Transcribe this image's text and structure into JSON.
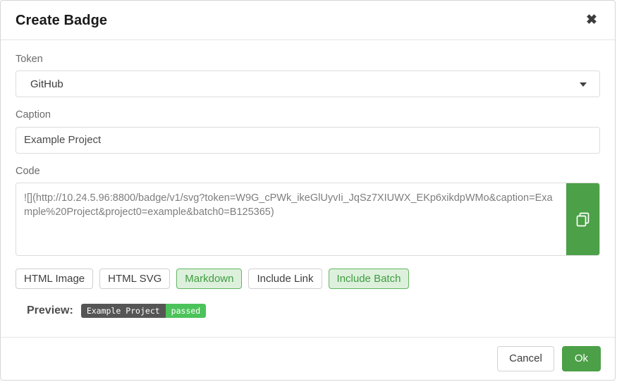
{
  "dialog": {
    "title": "Create Badge",
    "close_icon": "close-icon"
  },
  "form": {
    "token": {
      "label": "Token",
      "value": "GitHub",
      "arrow_icon": "chevron-down-icon"
    },
    "caption": {
      "label": "Caption",
      "value": "Example Project",
      "placeholder": "Caption"
    },
    "code": {
      "label": "Code",
      "value": "![](http://10.24.5.96:8800/badge/v1/svg?token=W9G_cPWk_ikeGlUyvIi_JqSz7XIUWX_EKp6xikdpWMo&caption=Example%20Project&project0=example&batch0=B125365)",
      "copy_icon": "copy-icon"
    }
  },
  "format_toggles": [
    {
      "label": "HTML Image",
      "active": false
    },
    {
      "label": "HTML SVG",
      "active": false
    },
    {
      "label": "Markdown",
      "active": true
    },
    {
      "label": "Include Link",
      "active": false
    },
    {
      "label": "Include Batch",
      "active": true
    }
  ],
  "preview": {
    "label": "Preview:",
    "badge_caption": "Example Project",
    "badge_status": "passed"
  },
  "footer": {
    "cancel_label": "Cancel",
    "ok_label": "Ok"
  },
  "colors": {
    "accent_green": "#4ca048",
    "toggle_active_bg": "#ddf0dc",
    "toggle_active_text": "#3f9c42",
    "badge_left_bg": "#555555",
    "badge_right_bg": "#4cc35a",
    "border": "#dcdcdc"
  }
}
